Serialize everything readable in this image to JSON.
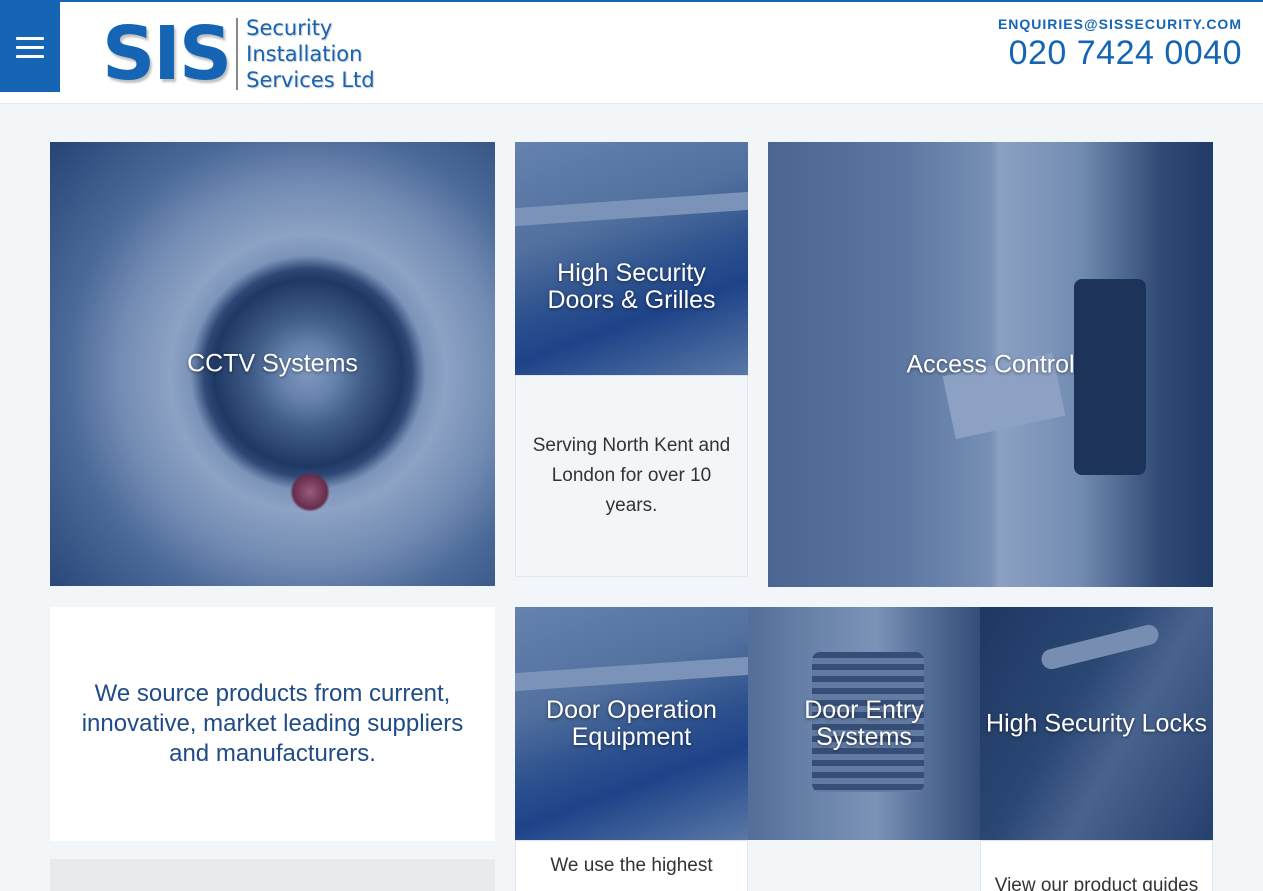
{
  "header": {
    "logo": {
      "mark": "SIS",
      "lines": [
        "Security",
        "Installation",
        "Services Ltd"
      ]
    },
    "email": "ENQUIRIES@SISSECURITY.COM",
    "phone": "020 7424 0040"
  },
  "tiles": {
    "cctv": "CCTV Systems",
    "doors_grilles": "High Security Doors & Grilles",
    "access_control": "Access Control",
    "door_operation": "Door Operation Equipment",
    "door_entry": "Door Entry Systems",
    "locks": "High Security Locks"
  },
  "panels": {
    "serving": "Serving North Kent and London for over 10 years.",
    "source": "We source products from current, innovative, market leading suppliers and manufacturers.",
    "quality": "We use the highest",
    "guides": "View our product guides"
  },
  "colors": {
    "brand_blue": "#1565b4",
    "text_dark_blue": "#1f4b87",
    "page_bg": "#f2f6f9"
  }
}
